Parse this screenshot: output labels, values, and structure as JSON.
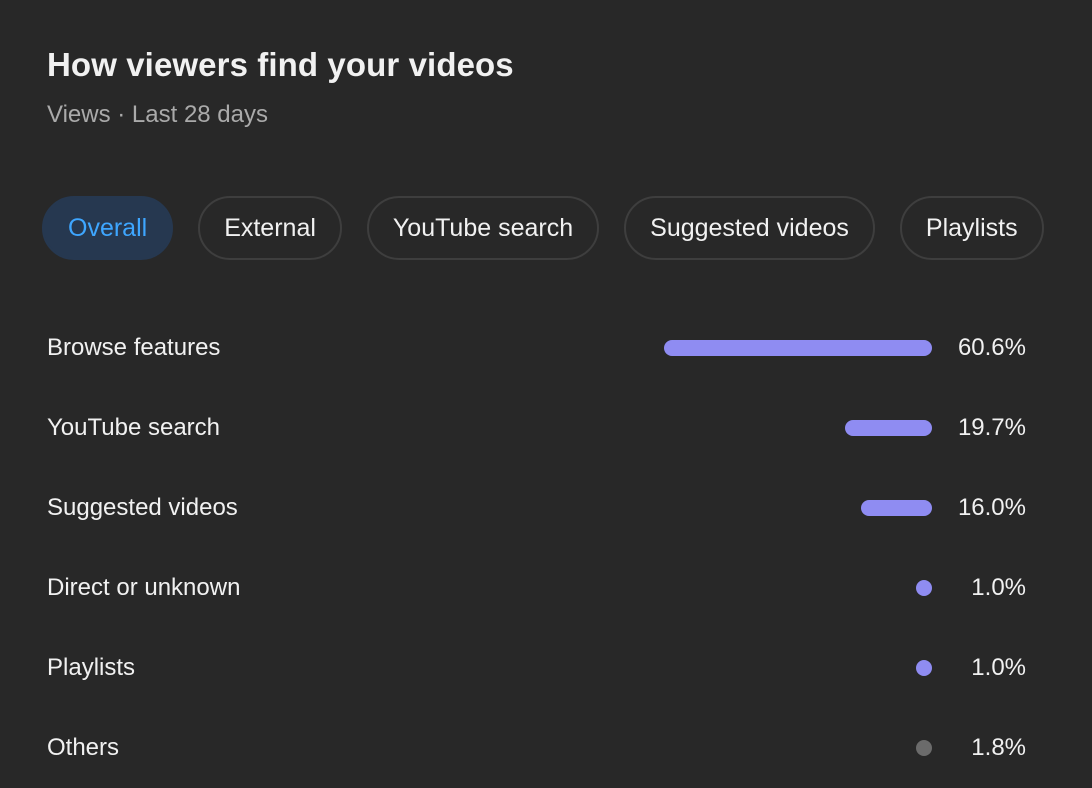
{
  "header": {
    "title": "How viewers find your videos",
    "subtitle": "Views · Last 28 days"
  },
  "tabs": [
    {
      "label": "Overall",
      "selected": true
    },
    {
      "label": "External",
      "selected": false
    },
    {
      "label": "YouTube search",
      "selected": false
    },
    {
      "label": "Suggested videos",
      "selected": false
    },
    {
      "label": "Playlists",
      "selected": false
    }
  ],
  "colors": {
    "bar": "#8f8cf2",
    "bar_other": "#6b6b6b",
    "selected_chip_bg": "#263850",
    "selected_chip_text": "#3ea6ff"
  },
  "traffic_sources": [
    {
      "label": "Browse features",
      "value_text": "60.6%",
      "value": 60.6,
      "other": false
    },
    {
      "label": "YouTube search",
      "value_text": "19.7%",
      "value": 19.7,
      "other": false
    },
    {
      "label": "Suggested videos",
      "value_text": "16.0%",
      "value": 16.0,
      "other": false
    },
    {
      "label": "Direct or unknown",
      "value_text": "1.0%",
      "value": 1.0,
      "other": false
    },
    {
      "label": "Playlists",
      "value_text": "1.0%",
      "value": 1.0,
      "other": false
    },
    {
      "label": "Others",
      "value_text": "1.8%",
      "value": 1.8,
      "other": true
    }
  ]
}
